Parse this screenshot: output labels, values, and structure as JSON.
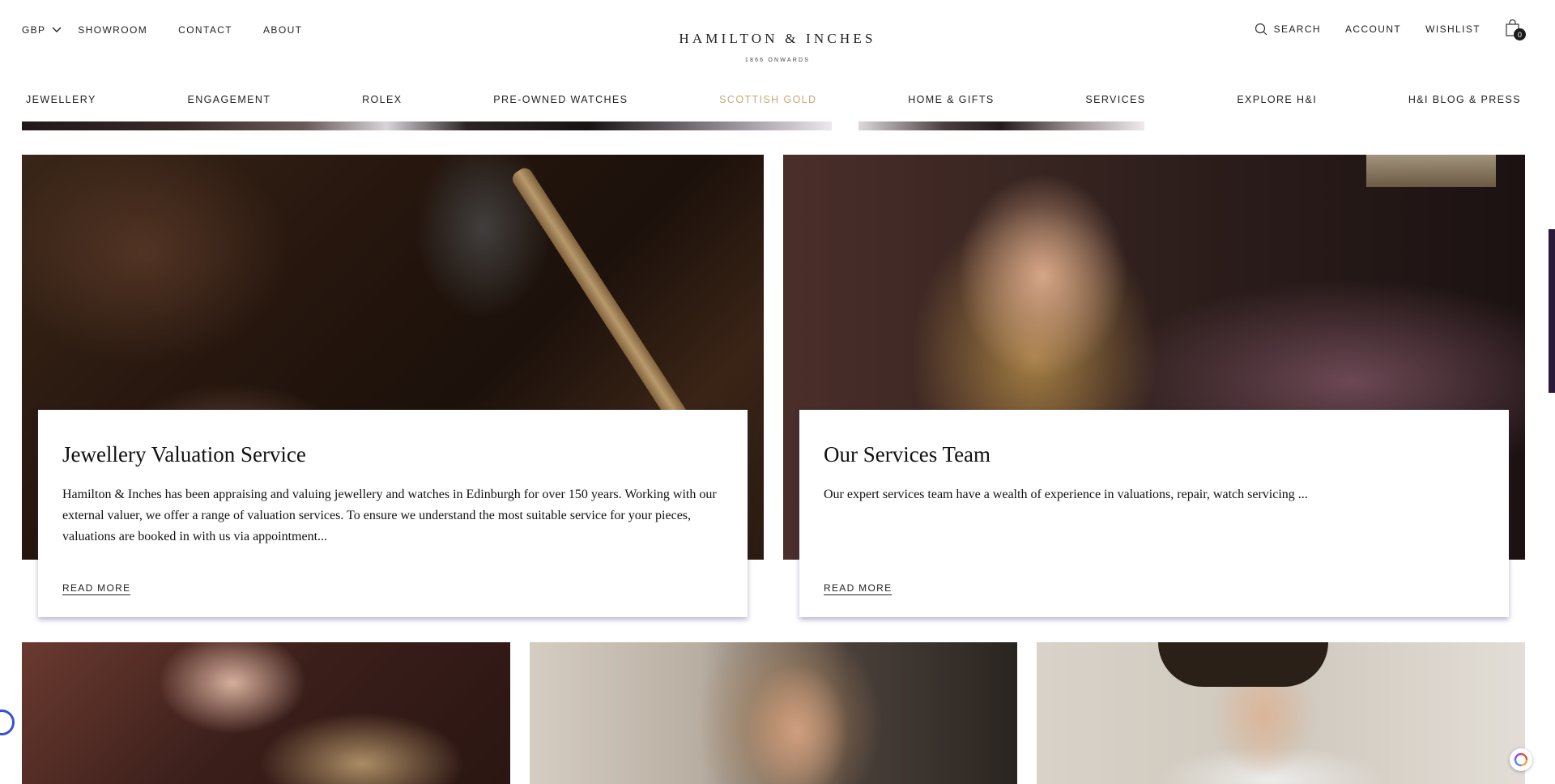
{
  "header": {
    "currency": "GBP",
    "util_left": [
      "SHOWROOM",
      "CONTACT",
      "ABOUT"
    ],
    "brand": "HAMILTON  &  INCHES",
    "established": "1866 ONWARDS",
    "search_label": "SEARCH",
    "account_label": "ACCOUNT",
    "wishlist_label": "WISHLIST",
    "bag_count": "0"
  },
  "nav": {
    "items": [
      "JEWELLERY",
      "ENGAGEMENT",
      "ROLEX",
      "PRE-OWNED WATCHES",
      "SCOTTISH GOLD",
      "HOME & GIFTS",
      "SERVICES",
      "EXPLORE H&I",
      "H&I BLOG & PRESS"
    ],
    "accent_color": "#c8a87a"
  },
  "cards": [
    {
      "title": "Jewellery Valuation Service",
      "body": "Hamilton & Inches has been appraising and valuing jewellery and watches in Edinburgh for over 150 years. Working with our external valuer, we offer a range of valuation services. To ensure we understand the most suitable service for your pieces, valuations are booked in with us via appointment...",
      "link": "READ MORE"
    },
    {
      "title": "Our Services Team",
      "body": "Our expert services team have a wealth of experience in valuations, repair, watch servicing ...",
      "link": "READ MORE"
    }
  ],
  "icons": {
    "currency_chevron": "chevron-down-icon",
    "search": "search-icon",
    "bag": "shopping-bag-icon",
    "accessibility": "accessibility-icon",
    "help": "help-widget-icon"
  }
}
